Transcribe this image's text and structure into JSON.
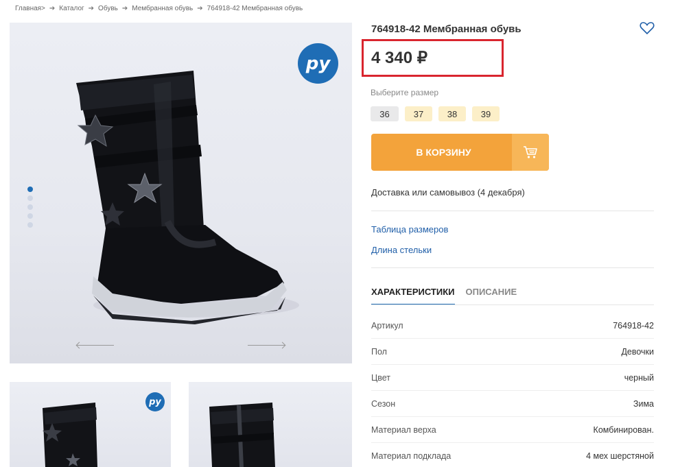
{
  "breadcrumb": {
    "items": [
      "Главная>",
      "Каталог",
      "Обувь",
      "Мембранная обувь",
      "764918-42 Мембранная обувь"
    ]
  },
  "gallery": {
    "badge_text": "ру",
    "badge_color": "#1f6db5",
    "dots": 5,
    "active_dot": 0,
    "thumb_badge_text": "ру"
  },
  "product": {
    "title": "764918-42 Мембранная обувь",
    "price": "4 340 ₽",
    "favorite_icon": "heart-outline-icon"
  },
  "size_picker": {
    "label": "Выберите размер",
    "sizes": [
      "36",
      "37",
      "38",
      "39"
    ]
  },
  "cart": {
    "label": "В КОРЗИНУ",
    "icon": "cart-icon",
    "color": "#f3a33b"
  },
  "delivery": "Доставка или самовывоз (4 декабря)",
  "links": {
    "size_table": "Таблица размеров",
    "insole_length": "Длина стельки"
  },
  "tabs": [
    {
      "label": "ХАРАКТЕРИСТИКИ",
      "active": true
    },
    {
      "label": "ОПИСАНИЕ",
      "active": false
    }
  ],
  "specs": [
    {
      "key": "Артикул",
      "value": "764918-42"
    },
    {
      "key": "Пол",
      "value": "Девочки"
    },
    {
      "key": "Цвет",
      "value": "черный"
    },
    {
      "key": "Сезон",
      "value": "Зима"
    },
    {
      "key": "Материал верха",
      "value": "Комбинирован."
    },
    {
      "key": "Материал подклада",
      "value": "4 мех шерстяной"
    }
  ],
  "colors": {
    "accent": "#1f6db5",
    "link": "#1f5ea8",
    "highlight_box": "#d9252e"
  }
}
